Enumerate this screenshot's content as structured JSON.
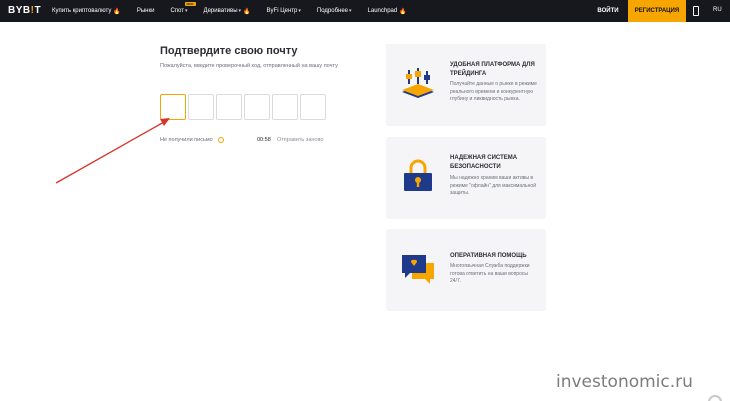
{
  "header": {
    "logo_text": "BYB",
    "logo_bar": "!",
    "logo_tail": "T",
    "nav": [
      {
        "label": "Купить криптовалюту",
        "flame": "🔥"
      },
      {
        "label": "Рынки"
      },
      {
        "label": "Спот",
        "badge": "NEW"
      },
      {
        "label": "Деривативы",
        "flame": "🔥"
      },
      {
        "label": "ByFi Центр"
      },
      {
        "label": "Подробнее"
      },
      {
        "label": "Launchpad",
        "flame": "🔥"
      }
    ],
    "login_label": "ВОЙТИ",
    "register_label": "РЕГИСТРАЦИЯ",
    "language": "RU"
  },
  "form": {
    "title": "Подтвердите свою почту",
    "subtitle": "Пожалуйста, введите проверочный код, отправленный на вашу почту",
    "code_length": 6,
    "no_email_label": "Не получили письмо",
    "timer": "00:58",
    "resend_label": "Отправить заново"
  },
  "features": [
    {
      "icon": "trading-platform-icon",
      "title": "УДОБНАЯ ПЛАТФОРМА ДЛЯ ТРЕЙДИНГА",
      "text": "Получайте данные о рынке в режиме реального времени и конкурентную глубину и ликвидность рынка."
    },
    {
      "icon": "lock-icon",
      "title": "НАДЕЖНАЯ СИСТЕМА БЕЗОПАСНОСТИ",
      "text": "Мы надежно храним ваши активы в режиме \"офлайн\" для максимальной защиты."
    },
    {
      "icon": "chat-support-icon",
      "title": "ОПЕРАТИВНАЯ ПОМОЩЬ",
      "text": "Многоязычная Служба поддержки готова ответить на ваши вопросы 24/7."
    }
  ],
  "watermark": "investonomic.ru",
  "colors": {
    "accent": "#f7a600",
    "header_bg": "#17181e",
    "card_bg": "#f5f5f7",
    "icon_blue": "#1f3a8a",
    "arrow": "#d9342b"
  }
}
